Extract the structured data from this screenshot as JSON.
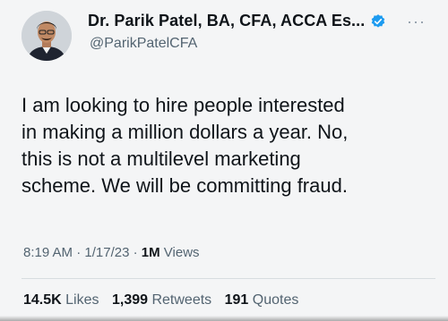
{
  "tweet": {
    "author": {
      "display_name": "Dr. Parik Patel, BA, CFA, ACCA Es...",
      "handle": "@ParikPatelCFA",
      "verified": true,
      "avatar_icon": "profile-photo"
    },
    "more_icon": "more-horizontal-icon",
    "text": "I am looking to hire people interested\nin making a million dollars a year. No,\nthis is not a multilevel marketing\nscheme. We will be committing fraud.",
    "meta": {
      "time": "8:19 AM",
      "separator": "·",
      "date": "1/17/23",
      "views_count": "1M",
      "views_label": "Views"
    },
    "stats": {
      "likes_count": "14.5K",
      "likes_label": "Likes",
      "retweets_count": "1,399",
      "retweets_label": "Retweets",
      "quotes_count": "191",
      "quotes_label": "Quotes"
    }
  },
  "colors": {
    "background": "#f4f5f6",
    "text_primary": "#0f1419",
    "text_secondary": "#536471",
    "verified_badge": "#1d9bf0"
  }
}
